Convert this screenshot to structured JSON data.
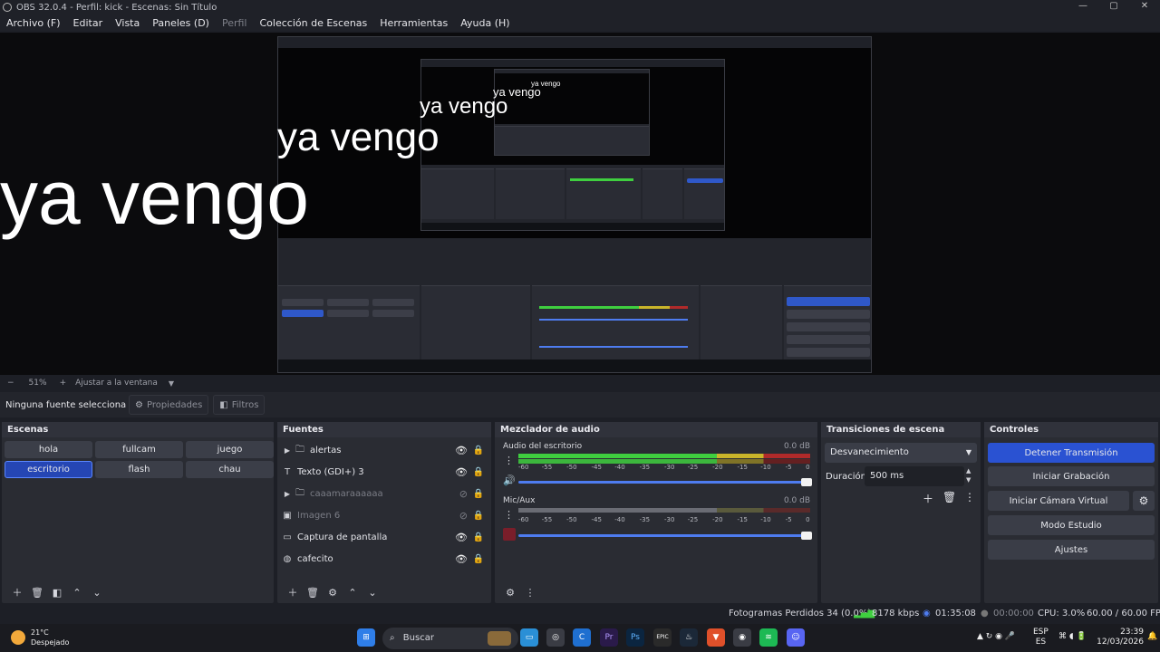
{
  "window": {
    "title": "OBS 32.0.4 - Perfil: kick - Escenas: Sin Título",
    "controls": [
      "—",
      "▢",
      "✕"
    ]
  },
  "menu": [
    {
      "label": "Archivo (F)"
    },
    {
      "label": "Editar"
    },
    {
      "label": "Vista"
    },
    {
      "label": "Paneles (D)"
    },
    {
      "label": "Perfil"
    },
    {
      "label": "Colección de Escenas"
    },
    {
      "label": "Herramientas"
    },
    {
      "label": "Ayuda (H)"
    }
  ],
  "preview": {
    "text": "ya vengo"
  },
  "zoom": {
    "minus": "−",
    "value": "51%",
    "plus": "+",
    "fit_label": "Ajustar a la ventana"
  },
  "context": {
    "no_source": "Ninguna fuente selecciona",
    "properties": "Propiedades",
    "filters": "Filtros"
  },
  "scenes": {
    "title": "Escenas",
    "items": [
      "hola",
      "fullcam",
      "juego",
      "escritorio",
      "flash",
      "chau"
    ],
    "active": "escritorio"
  },
  "sources": {
    "title": "Fuentes",
    "items": [
      {
        "label": "alertas",
        "icon": "folder-icon",
        "visible": true
      },
      {
        "label": "Texto (GDI+) 3",
        "icon": "text-icon",
        "visible": true
      },
      {
        "label": "caaamaraaaaaa",
        "icon": "folder-icon",
        "visible": false
      },
      {
        "label": "Imagen 6",
        "icon": "image-icon",
        "visible": false
      },
      {
        "label": "Captura de pantalla",
        "icon": "monitor-icon",
        "visible": true
      },
      {
        "label": "cafecito",
        "icon": "globe-icon",
        "visible": true
      }
    ]
  },
  "mixer": {
    "title": "Mezclador de audio",
    "channels": [
      {
        "name": "Audio del escritorio",
        "db": "0.0 dB"
      },
      {
        "name": "Mic/Aux",
        "db": "0.0 dB"
      }
    ],
    "ticks": [
      "-60",
      "-55",
      "-50",
      "-45",
      "-40",
      "-35",
      "-30",
      "-25",
      "-20",
      "-15",
      "-10",
      "-5",
      "0"
    ]
  },
  "transitions": {
    "title": "Transiciones de escena",
    "selected": "Desvanecimiento",
    "duration_label": "Duración",
    "duration_value": "500 ms"
  },
  "controls": {
    "title": "Controles",
    "stop_stream": "Detener Transmisión",
    "start_record": "Iniciar Grabación",
    "virtual_cam": "Iniciar Cámara Virtual",
    "studio_mode": "Modo Estudio",
    "settings": "Ajustes"
  },
  "status": {
    "dropped": "Fotogramas Perdidos 34 (0.0%)",
    "bitrate": "8178 kbps",
    "stream_time": "01:35:08",
    "rec_time": "00:00:00",
    "cpu": "CPU: 3.0%",
    "fps": "60.00 / 60.00 FPS"
  },
  "taskbar": {
    "temp": "21°C",
    "weather": "Despejado",
    "search": "Buscar",
    "lang1": "ESP",
    "lang2": "ES",
    "time": "23:39",
    "date": "12/03/2026",
    "apps": [
      "Pr",
      "Ps",
      "EPIC"
    ]
  },
  "colors": {
    "accent": "#2a52d2",
    "panel": "#2a2c33",
    "meter_green": "#3fcf3f",
    "meter_yellow": "#c9b52a",
    "meter_red": "#b02a2a"
  }
}
